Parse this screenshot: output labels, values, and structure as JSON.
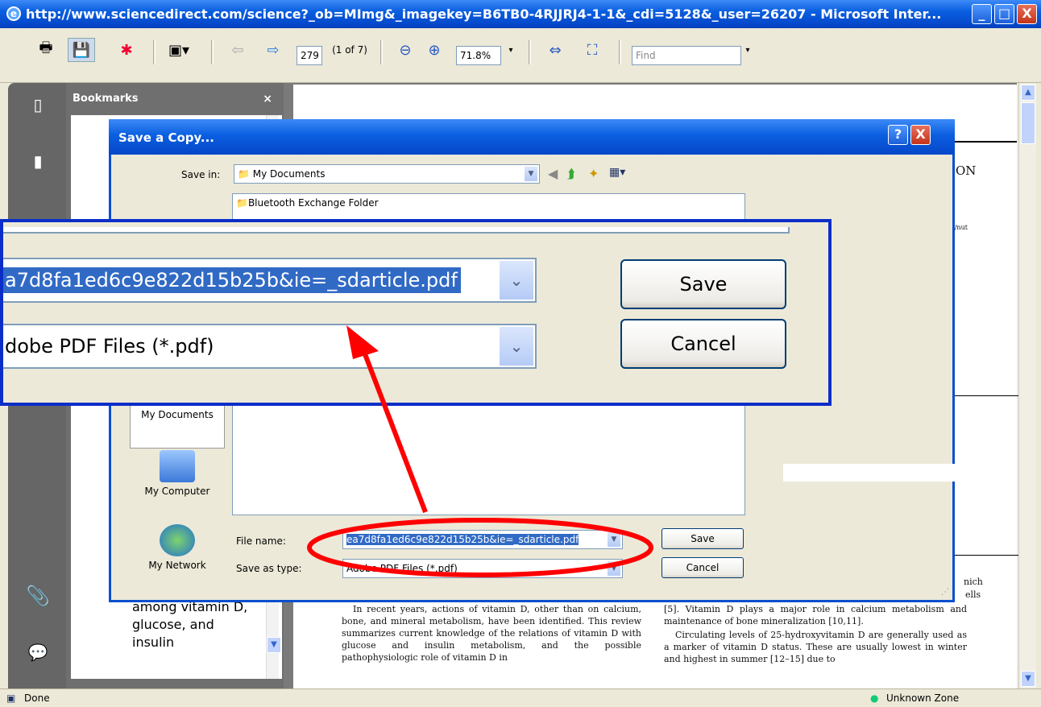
{
  "window": {
    "title": "http://www.sciencedirect.com/science?_ob=MImg&_imagekey=B6TB0-4RJJRJ4-1-1&_cdi=5128&_user=26207 - Microsoft Inter...",
    "minimize": "_",
    "maximize": "□",
    "close": "X"
  },
  "toolbar": {
    "page_number": "279",
    "page_of": "(1 of 7)",
    "zoom_level": "71.8%",
    "find_placeholder": "Find"
  },
  "bookmarks": {
    "header": "Bookmarks",
    "close": "×",
    "visible_item": "among vitamin D,\nglucose, and\ninsulin"
  },
  "document": {
    "left_column": "In recent years, actions of vitamin D, other than on calcium, bone, and mineral metabolism, have been identified. This review summarizes current knowledge of the relations of vitamin D with glucose and insulin metabolism, and the possible pathophysiologic role of vitamin D in",
    "right_column_1": "[5]. Vitamin D plays a major role in calcium metabolism and maintenance of bone mineralization [10,11].",
    "right_column_2": "Circulating levels of 25-hydroxyvitamin D are generally used as a marker of vitamin D status. These are usually lowest in winter and highest in summer [12–15] due to",
    "corner_fragment_1": "ON",
    "corner_fragment_2": "ate/nut",
    "frag_nich": "nich",
    "frag_ells": "ells"
  },
  "dialog": {
    "title": "Save a Copy...",
    "help": "?",
    "close": "X",
    "save_in_label": "Save in:",
    "save_in_value": "My Documents",
    "files": [
      "Bluetooth Exchange Folder"
    ],
    "places": [
      "My Documents",
      "My Computer",
      "My Network"
    ],
    "file_name_label": "File name:",
    "file_name_value": "ea7d8fa1ed6c9e822d15b25b&ie=_sdarticle.pdf",
    "save_type_label": "Save as type:",
    "save_type_value": "Adobe PDF Files (*.pdf)",
    "save_button": "Save",
    "cancel_button": "Cancel"
  },
  "zoom_inset": {
    "file_name_value": "a7d8fa1ed6c9e822d15b25b&ie=_sdarticle.pdf",
    "save_type_value": "dobe PDF Files (*.pdf)",
    "save_button": "Save",
    "cancel_button": "Cancel"
  },
  "status": {
    "left": "Done",
    "zone": "Unknown Zone"
  },
  "colors": {
    "xp_blue": "#0a5fe0",
    "annotation_red": "#ff0000",
    "zoom_border": "#0b2ec8"
  }
}
